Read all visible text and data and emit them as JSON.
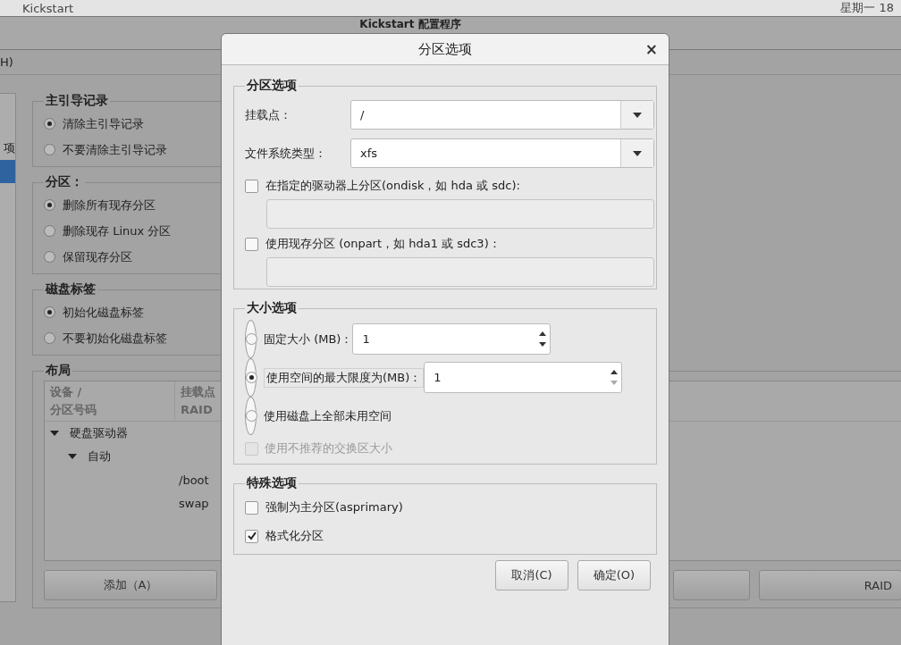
{
  "top_panel": {
    "app": "Kickstart",
    "clock": "星期一 18"
  },
  "main_window": {
    "title": "Kickstart 配置程序",
    "menu": [
      "H)"
    ],
    "sidebar": {
      "items": [
        {
          "label": "项",
          "selected": false
        },
        {
          "selected": true
        }
      ]
    },
    "groups": [
      {
        "title": "主引导记录",
        "options": [
          {
            "label": "清除主引导记录",
            "selected": true
          },
          {
            "label": "不要清除主引导记录",
            "selected": false
          }
        ]
      },
      {
        "title": "分区：",
        "options": [
          {
            "label": "删除所有现存分区",
            "selected": true
          },
          {
            "label": "删除现存  Linux 分区",
            "selected": false
          },
          {
            "label": "保留现存分区",
            "selected": false
          }
        ]
      },
      {
        "title": "磁盘标签",
        "options": [
          {
            "label": "初始化磁盘标签",
            "selected": true
          },
          {
            "label": "不要初始化磁盘标签",
            "selected": false
          }
        ]
      }
    ],
    "layout": {
      "title": "布局",
      "columns": [
        {
          "lines": [
            "设备 /",
            "分区号码"
          ]
        },
        {
          "lines": [
            "挂载点",
            "RAID"
          ]
        }
      ],
      "tree": [
        {
          "label": "硬盘驱动器",
          "expanded": true,
          "children": [
            {
              "label": "自动",
              "expanded": true,
              "children": [
                {
                  "mount": "/boot"
                },
                {
                  "mount": "swap"
                }
              ]
            }
          ]
        }
      ],
      "buttons": [
        "添加（A）",
        "RAID"
      ]
    }
  },
  "dialog": {
    "title": "分区选项",
    "close": "×",
    "partition": {
      "title": "分区选项",
      "mount_label": "挂载点：",
      "mount_value": "/",
      "fs_label": "文件系统类型：",
      "fs_value": "xfs",
      "ondisk": {
        "label": "在指定的驱动器上分区(ondisk，如  hda 或  sdc):",
        "checked": false
      },
      "onpart": {
        "label": "使用现存分区 (onpart，如  hda1 或  sdc3)：",
        "checked": false
      }
    },
    "size": {
      "title": "大小选项",
      "options": [
        {
          "kind": "radio",
          "label": "固定大小 (MB)：",
          "selected": false,
          "value": "1"
        },
        {
          "kind": "radio",
          "label": "使用空间的最大限度为(MB)：",
          "selected": true,
          "value": "1"
        },
        {
          "kind": "radio",
          "label": "使用磁盘上全部未用空间",
          "selected": false
        },
        {
          "kind": "checkbox",
          "label": "使用不推荐的交换区大小",
          "checked": false,
          "disabled": true
        }
      ]
    },
    "special": {
      "title": "特殊选项",
      "options": [
        {
          "label": "强制为主分区(asprimary)",
          "checked": false
        },
        {
          "label": "格式化分区",
          "checked": true
        }
      ]
    },
    "buttons": [
      "取消(C)",
      "确定(O)"
    ]
  }
}
